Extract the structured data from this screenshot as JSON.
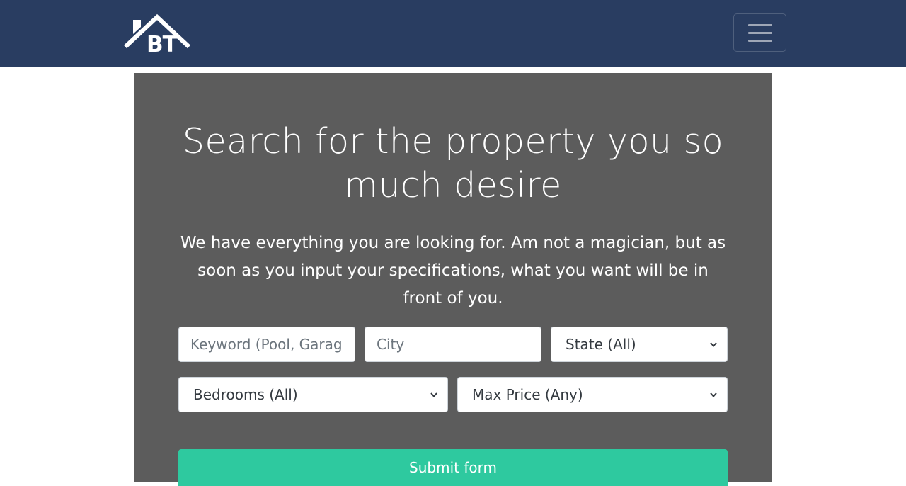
{
  "brand": {
    "logo_text": "BT"
  },
  "navbar": {
    "toggle_label": "Toggle navigation"
  },
  "hero": {
    "title": "Search for the property you so much desire",
    "description": "We have everything you are looking for. Am not a magician, but as soon as you input your specifications, what you want will be in front of you."
  },
  "search": {
    "keyword_placeholder": "Keyword (Pool, Garage, etc)",
    "city_placeholder": "City",
    "state_selected": "State (All)",
    "bedrooms_selected": "Bedrooms (All)",
    "max_price_selected": "Max Price (Any)",
    "submit_label": "Submit form"
  },
  "colors": {
    "navbar": "#293d61",
    "panel": "#5c5c5c",
    "submit": "#2ec99f"
  },
  "icons": {
    "logo": "house-roof-logo",
    "toggle": "hamburger-menu-icon",
    "select": "chevron-down-icon"
  }
}
